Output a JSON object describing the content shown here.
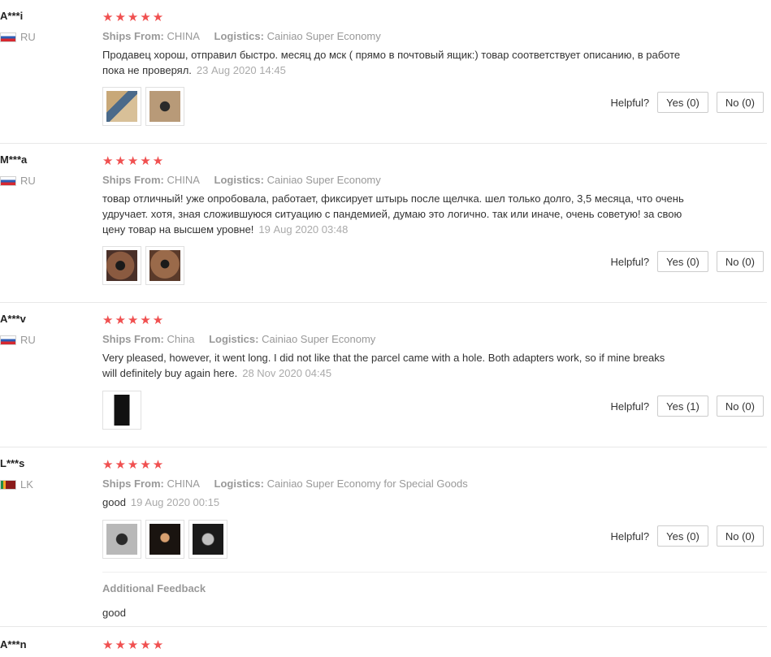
{
  "labels": {
    "ships_from": "Ships From:",
    "logistics": "Logistics:",
    "helpful": "Helpful?",
    "additional_feedback": "Additional Feedback"
  },
  "colors": {
    "star": "#f05050",
    "divider": "#e8e8e8"
  },
  "reviews": [
    {
      "user": "A***i",
      "country": "RU",
      "flag_icon": "russia-flag-icon",
      "stars": "★★★★★",
      "rating": 5,
      "ships_from": "CHINA",
      "logistics": "Cainiao Super Economy",
      "text": "Продавец хорош, отправил быстро. месяц до мск ( прямо в почтовый ящик:) товар соответствует описанию, в работе пока не проверял.",
      "date": "23 Aug 2020 14:45",
      "yes": "Yes (0)",
      "no": "No (0)"
    },
    {
      "user": "M***a",
      "country": "RU",
      "flag_icon": "russia-flag-icon",
      "stars": "★★★★★",
      "rating": 5,
      "ships_from": "CHINA",
      "logistics": "Cainiao Super Economy",
      "text": "товар отличный! уже опробовала, работает, фиксирует штырь после щелчка. шел только долго, 3,5 месяца, что очень удручает. хотя, зная сложившуюся ситуацию с пандемией, думаю это логично. так или иначе, очень советую! за свою цену товар на высшем уровне!",
      "date": "19 Aug 2020 03:48",
      "yes": "Yes (0)",
      "no": "No (0)"
    },
    {
      "user": "A***v",
      "country": "RU",
      "flag_icon": "russia-flag-icon",
      "stars": "★★★★★",
      "rating": 5,
      "ships_from": "China",
      "logistics": "Cainiao Super Economy",
      "text": "Very pleased, however, it went long. I did not like that the parcel came with a hole. Both adapters work, so if mine breaks will definitely buy again here.",
      "date": "28 Nov 2020 04:45",
      "yes": "Yes (1)",
      "no": "No (0)"
    },
    {
      "user": "L***s",
      "country": "LK",
      "flag_icon": "sri-lanka-flag-icon",
      "stars": "★★★★★",
      "rating": 5,
      "ships_from": "CHINA",
      "logistics": "Cainiao Super Economy for Special Goods",
      "text": "good",
      "date": "19 Aug 2020 00:15",
      "yes": "Yes (0)",
      "no": "No (0)",
      "additional_feedback": "good"
    },
    {
      "user": "A***n",
      "stars": "★★★★★",
      "rating": 5
    }
  ]
}
